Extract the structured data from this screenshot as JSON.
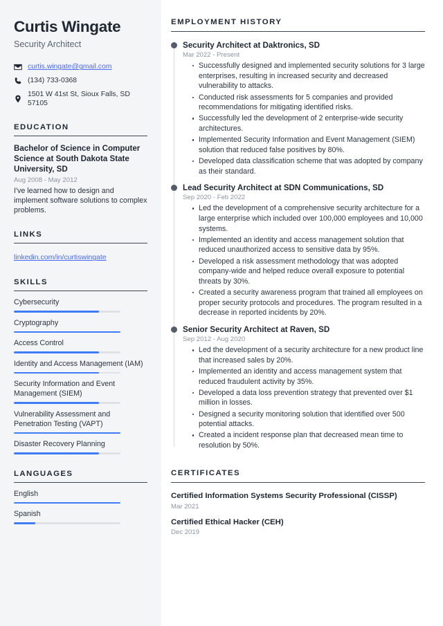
{
  "theme": {
    "accent": "#3d7bf7",
    "link_color": "#4a69f4",
    "sidebar_bg": "#f4f5f7",
    "text_color": "#2b3440",
    "muted_color": "#8d94a0"
  },
  "header": {
    "name": "Curtis Wingate",
    "job_title": "Security Architect"
  },
  "contact": [
    {
      "icon": "envelope-icon",
      "text": "curtis.wingate@gmail.com",
      "is_link": true
    },
    {
      "icon": "phone-icon",
      "text": "(134) 733-0368",
      "is_link": false
    },
    {
      "icon": "map-pin-icon",
      "text": "1501 W 41st St, Sioux Falls, SD 57105",
      "is_link": false
    }
  ],
  "education": {
    "title": "Education",
    "degree": "Bachelor of Science in Computer Science at South Dakota State University, SD",
    "date": "Aug 2008 - May 2012",
    "description": "I've learned how to design and implement software solutions to complex problems."
  },
  "links": {
    "title": "Links",
    "items": [
      {
        "label": "linkedin.com/in/curtiswingate"
      }
    ]
  },
  "skills": {
    "title": "Skills",
    "items": [
      {
        "label": "Cybersecurity",
        "level": 80
      },
      {
        "label": "Cryptography",
        "level": 100
      },
      {
        "label": "Access Control",
        "level": 80
      },
      {
        "label": "Identity and Access Management (IAM)",
        "level": 80
      },
      {
        "label": "Security Information and Event Management (SIEM)",
        "level": 80
      },
      {
        "label": "Vulnerability Assessment and Penetration Testing (VAPT)",
        "level": 100
      },
      {
        "label": "Disaster Recovery Planning",
        "level": 80
      }
    ]
  },
  "languages": {
    "title": "Languages",
    "items": [
      {
        "label": "English",
        "level": 100
      },
      {
        "label": "Spanish",
        "level": 20
      }
    ]
  },
  "employment": {
    "title": "Employment History",
    "jobs": [
      {
        "role": "Security Architect at Daktronics, SD",
        "date": "Mar 2022 - Present",
        "bullets": [
          "Successfully designed and implemented security solutions for 3 large enterprises, resulting in increased security and decreased vulnerability to attacks.",
          "Conducted risk assessments for 5 companies and provided recommendations for mitigating identified risks.",
          "Successfully led the development of 2 enterprise-wide security architectures.",
          "Implemented Security Information and Event Management (SIEM) solution that reduced false positives by 80%.",
          "Developed data classification scheme that was adopted by company as their standard."
        ]
      },
      {
        "role": "Lead Security Architect at SDN Communications, SD",
        "date": "Sep 2020 - Feb 2022",
        "bullets": [
          "Led the development of a comprehensive security architecture for a large enterprise which included over 100,000 employees and 10,000 systems.",
          "Implemented an identity and access management solution that reduced unauthorized access to sensitive data by 95%.",
          "Developed a risk assessment methodology that was adopted company-wide and helped reduce overall exposure to potential threats by 30%.",
          "Created a security awareness program that trained all employees on proper security protocols and procedures. The program resulted in a decrease in reported incidents by 20%."
        ]
      },
      {
        "role": "Senior Security Architect at Raven, SD",
        "date": "Sep 2012 - Aug 2020",
        "bullets": [
          "Led the development of a security architecture for a new product line that increased sales by 20%.",
          "Implemented an identity and access management system that reduced fraudulent activity by 35%.",
          "Developed a data loss prevention strategy that prevented over $1 million in losses.",
          "Designed a security monitoring solution that identified over 500 potential attacks.",
          "Created a incident response plan that decreased mean time to resolution by 50%."
        ]
      }
    ]
  },
  "certificates": {
    "title": "Certificates",
    "items": [
      {
        "name": "Certified Information Systems Security Professional (CISSP)",
        "date": "Mar 2021"
      },
      {
        "name": "Certified Ethical Hacker (CEH)",
        "date": "Dec 2019"
      }
    ]
  }
}
